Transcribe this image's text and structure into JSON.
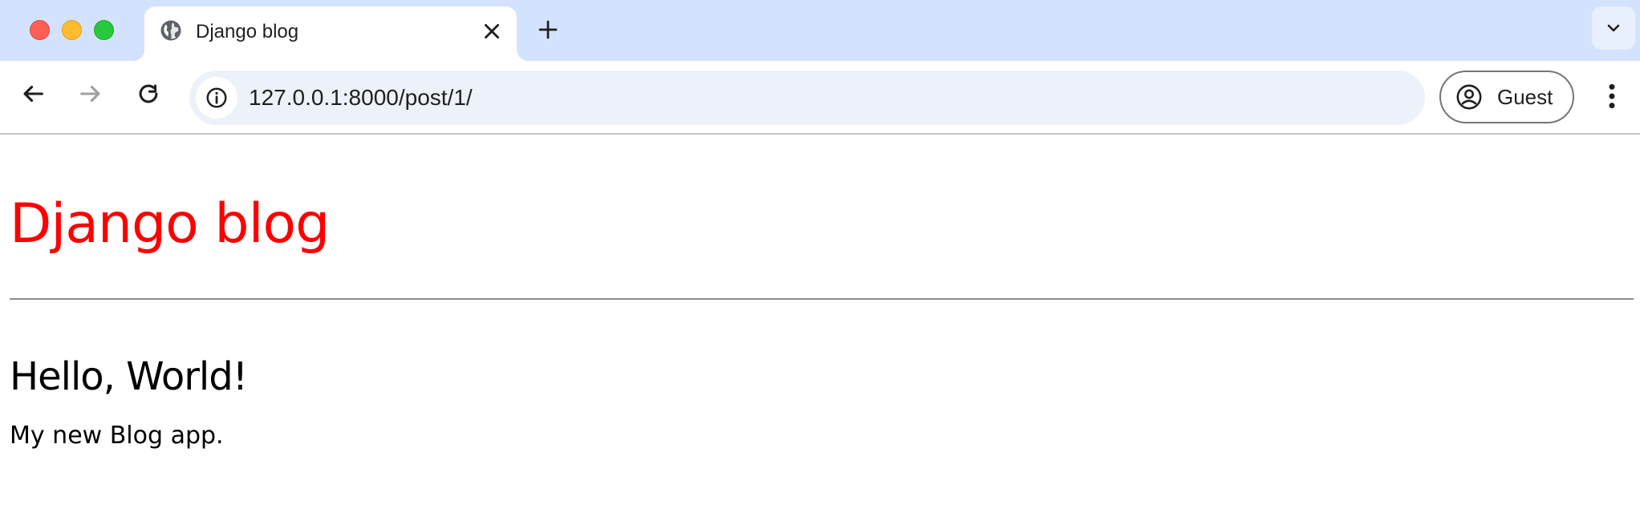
{
  "browser": {
    "tab": {
      "title": "Django blog",
      "favicon": "globe-icon"
    },
    "address_bar": {
      "url": "127.0.0.1:8000/post/1/",
      "site_info_icon": "info-icon"
    },
    "profile": {
      "label": "Guest",
      "icon": "account-circle-icon"
    },
    "icons": {
      "back": "arrow-left-icon",
      "forward": "arrow-right-icon",
      "reload": "reload-icon",
      "new_tab": "plus-icon",
      "tab_search": "chevron-down-icon",
      "menu": "kebab-menu-icon"
    }
  },
  "page": {
    "site_title": "Django blog",
    "post": {
      "title": "Hello, World!",
      "body": "My new Blog app."
    }
  },
  "colors": {
    "site_title": "#ff0000",
    "tabstrip_bg": "#d3e3fd",
    "omnibox_bg": "#edf1f9"
  }
}
